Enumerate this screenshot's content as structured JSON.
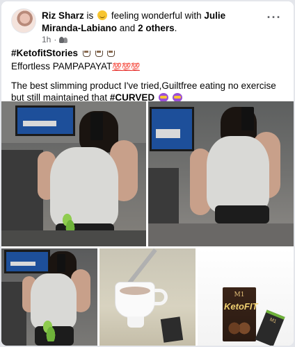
{
  "post": {
    "author": "Riz Sharz",
    "is_text": "is",
    "feeling": "feeling wonderful with",
    "tagged_name": "Julie Miranda-Labiano",
    "and_text": "and",
    "others": "2 others",
    "period": ".",
    "time": "1h",
    "privacy": "friends-icon",
    "more": "···"
  },
  "text": {
    "hashtag": "#KetofitStories",
    "line2": "Effortless PAMPAPAYAT",
    "hundreds": "💯💯💯",
    "line3": "The best slimming product I've tried,Guiltfree eating no exercise but still maintained that",
    "curved": "#CURVED"
  },
  "product": {
    "brand": "M1",
    "logo": "KetoFIT",
    "sachet": "M1"
  }
}
